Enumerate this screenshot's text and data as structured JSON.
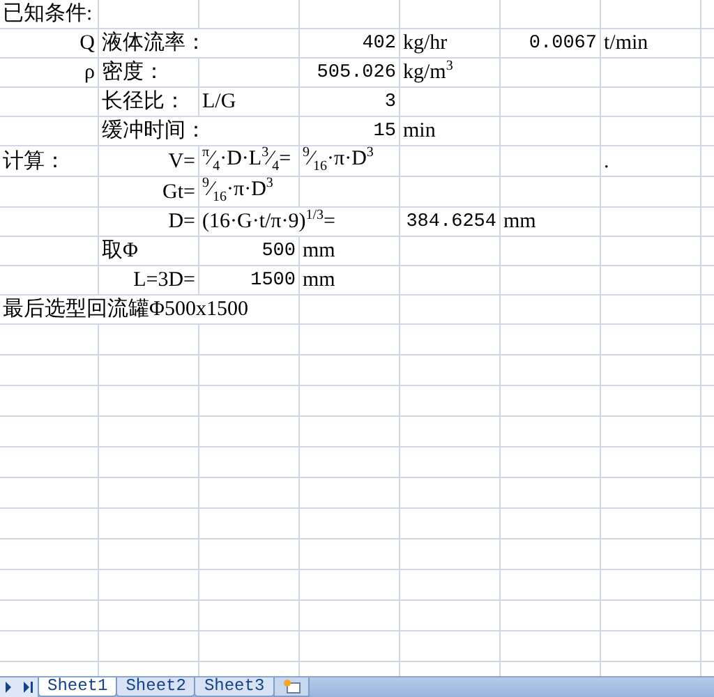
{
  "rows": [
    [
      {
        "kind": "text",
        "text": "已知条件:"
      },
      null,
      null,
      null,
      null,
      null,
      null
    ],
    [
      {
        "kind": "label",
        "text": "Q"
      },
      {
        "kind": "text",
        "text": "液体流率："
      },
      null,
      {
        "kind": "number",
        "text": "402"
      },
      {
        "kind": "text",
        "text": "kg/hr"
      },
      {
        "kind": "number",
        "text": "0.0067"
      },
      {
        "kind": "text",
        "text": "t/min"
      }
    ],
    [
      {
        "kind": "label",
        "text": "ρ"
      },
      {
        "kind": "text",
        "text": "密度："
      },
      null,
      {
        "kind": "number",
        "text": "505.026"
      },
      {
        "kind": "text",
        "text": "kg/m$^{3}$"
      },
      null,
      null
    ],
    [
      null,
      {
        "kind": "text",
        "text": "长径比："
      },
      {
        "kind": "text",
        "text": "L/G"
      },
      {
        "kind": "number",
        "text": "3"
      },
      null,
      null,
      null
    ],
    [
      null,
      {
        "kind": "text",
        "text": "缓冲时间："
      },
      null,
      {
        "kind": "number",
        "text": "15"
      },
      {
        "kind": "text",
        "text": "min"
      },
      null,
      null
    ],
    [
      {
        "kind": "text",
        "text": "计算："
      },
      {
        "kind": "label",
        "text": "V="
      },
      {
        "kind": "text",
        "text": "$^{π}$⁄$_{4}$·D·L$^{3}$⁄$_{4}$="
      },
      {
        "kind": "text",
        "text": "$^{9}$⁄$_{16}$·π·D$^{3}$"
      },
      null,
      null,
      {
        "kind": "text",
        "text": "."
      }
    ],
    [
      null,
      {
        "kind": "label",
        "text": "Gt="
      },
      {
        "kind": "text",
        "text": "$^{9}$⁄$_{16}$·π·D$^{3}$"
      },
      null,
      null,
      null,
      null
    ],
    [
      null,
      {
        "kind": "label",
        "text": "D="
      },
      {
        "kind": "text",
        "text": "(16·G·t/π·9)$^{1/3}$="
      },
      null,
      {
        "kind": "number",
        "text": "384.6254"
      },
      {
        "kind": "text",
        "text": "mm"
      },
      null
    ],
    [
      null,
      {
        "kind": "text",
        "text": "取Φ"
      },
      {
        "kind": "number",
        "text": "500"
      },
      {
        "kind": "text",
        "text": "mm"
      },
      null,
      null,
      null
    ],
    [
      null,
      {
        "kind": "label",
        "text": "L=3D="
      },
      {
        "kind": "number",
        "text": "1500"
      },
      {
        "kind": "text",
        "text": "mm"
      },
      null,
      null,
      null
    ],
    [
      {
        "kind": "text",
        "text": "最后选型回流罐Φ500x1500"
      },
      null,
      null,
      null,
      null,
      null,
      null
    ]
  ],
  "sheet_tabs": [
    {
      "label": "Sheet1",
      "selected": true
    },
    {
      "label": "Sheet2",
      "selected": false
    },
    {
      "label": "Sheet3",
      "selected": false
    }
  ]
}
